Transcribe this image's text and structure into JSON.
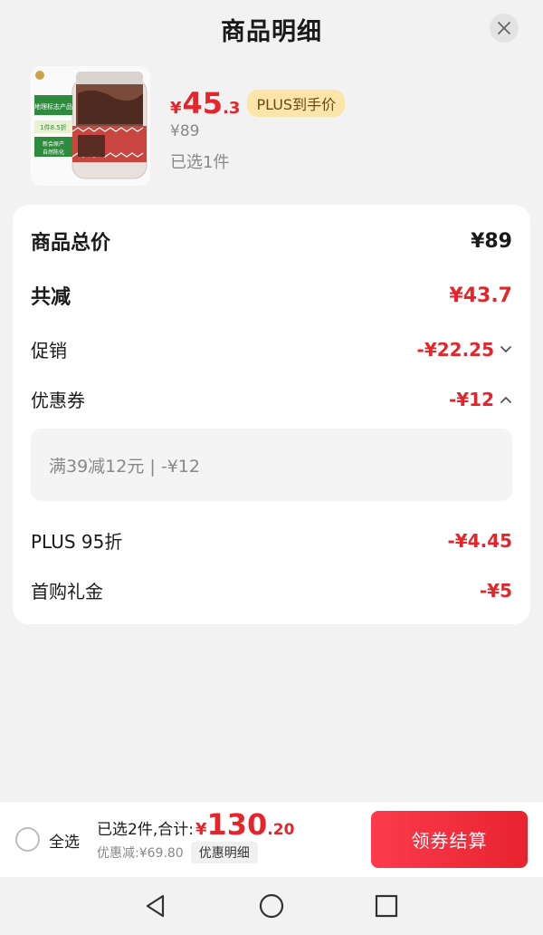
{
  "header": {
    "title": "商品明细"
  },
  "product": {
    "image_tags": [
      "地理标志产品",
      "1件8.5折",
      "新会原产",
      "自然陈化"
    ],
    "price_currency": "¥",
    "price_integer": "45",
    "price_decimal": ".3",
    "plus_badge": "PLUS到手价",
    "original_price": "¥89",
    "selected_count": "已选1件"
  },
  "breakdown": {
    "total_label": "商品总价",
    "total_value": "¥89",
    "reduce_label": "共减",
    "reduce_value": "¥43.7",
    "promo_label": "促销",
    "promo_value": "-¥22.25",
    "coupon_label": "优惠券",
    "coupon_value": "-¥12",
    "coupon_detail": "满39减12元 | -¥12",
    "plus_label": "PLUS 95折",
    "plus_value": "-¥4.45",
    "first_label": "首购礼金",
    "first_value": "-¥5"
  },
  "bottom": {
    "select_all": "全选",
    "summary_label": "已选2件,合计:",
    "total_currency": "¥",
    "total_integer": "130",
    "total_decimal": ".20",
    "discount_text": "优惠减:¥69.80",
    "detail_button": "优惠明细",
    "checkout_button": "领券结算"
  },
  "colors": {
    "accent": "#e4262c",
    "badge": "#fbe5a8"
  },
  "icons": [
    "close-icon",
    "chevron-down-icon",
    "chevron-up-icon",
    "back-icon",
    "home-icon",
    "recents-icon"
  ]
}
